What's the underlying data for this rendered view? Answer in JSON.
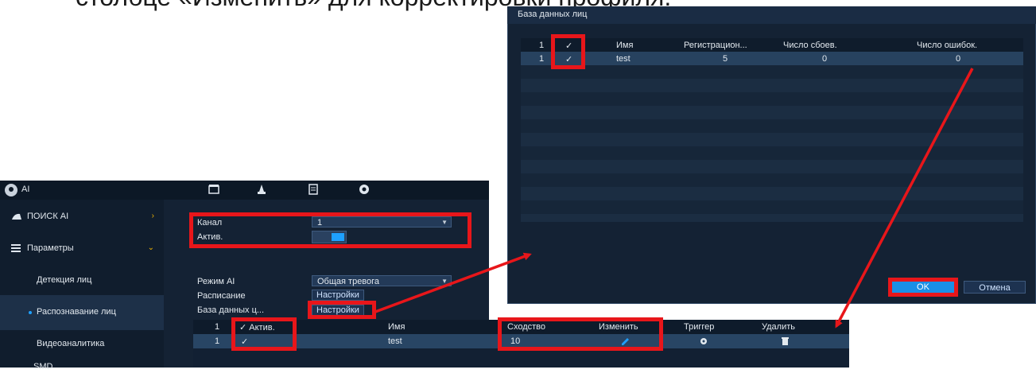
{
  "heading": "столбце «Изменить» для корректировки профиля.",
  "ai_window": {
    "title": "AI",
    "toolbar_icons": [
      "film-icon",
      "alarm-icon",
      "list-icon",
      "ai-face-icon"
    ],
    "sidebar": [
      {
        "label": "ПОИСК AI",
        "icon": "search-icon",
        "chevron": "›"
      },
      {
        "label": "Параметры",
        "icon": "menu-icon",
        "chevron": "⌄"
      },
      {
        "label": "Детекция лиц"
      },
      {
        "label": "Распознавание лиц"
      },
      {
        "label": "Видеоаналитика"
      },
      {
        "label": "SMD"
      }
    ],
    "form": {
      "channel_label": "Канал",
      "channel_value": "1",
      "active_label": "Актив.",
      "active_on": true,
      "mode_label": "Режим AI",
      "mode_value": "Общая тревога",
      "schedule_label": "Расписание",
      "schedule_btn": "Настройки",
      "db_label": "База данных ц...",
      "db_btn": "Настройки"
    },
    "table": {
      "headers": [
        "1",
        "✓ Актив.",
        "Имя",
        "Сходство",
        "Изменить",
        "Триггер",
        "Удалить"
      ],
      "row": {
        "num": "1",
        "check": "✓",
        "name": "test",
        "similarity": "10"
      }
    }
  },
  "face_db_window": {
    "title": "База данных лиц",
    "headers": [
      "1",
      "✓",
      "Имя",
      "Регистрацион...",
      "Число сбоев.",
      "Число ошибок."
    ],
    "rows": [
      {
        "num": "1",
        "check": "✓",
        "name": "test",
        "registered": "5",
        "fails": "0",
        "errors": "0"
      }
    ],
    "ok_label": "OK",
    "cancel_label": "Отмена"
  },
  "colors": {
    "accent": "#1ea0ff",
    "highlight": "#e8161a",
    "panel": "#142234"
  }
}
